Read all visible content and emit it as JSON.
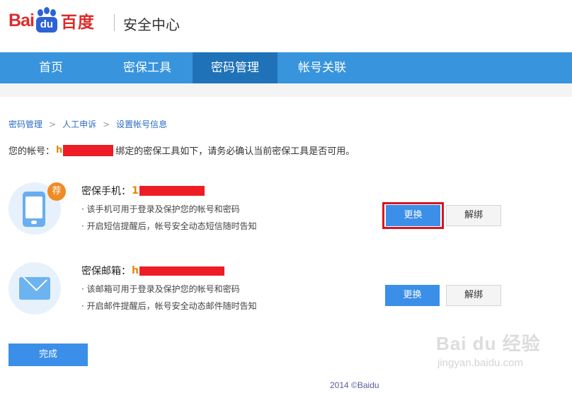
{
  "header": {
    "logo_text_left": "Bai",
    "logo_text_du": "du",
    "logo_text_cn": "百度",
    "title": "安全中心"
  },
  "nav": {
    "items": [
      {
        "label": "首页"
      },
      {
        "label": "密保工具"
      },
      {
        "label": "密码管理"
      },
      {
        "label": "帐号关联"
      }
    ],
    "active_index": 2
  },
  "breadcrumb": {
    "items": [
      "密码管理",
      "人工申诉",
      "设置帐号信息"
    ],
    "separator": ">"
  },
  "account": {
    "prefix": "您的帐号：",
    "visible_char": "h",
    "suffix": "绑定的密保工具如下，请务必确认当前密保工具是否可用。"
  },
  "phone_row": {
    "badge": "荐",
    "title_label": "密保手机：",
    "visible_char": "1",
    "desc1": "· 该手机可用于登录及保护您的帐号和密码",
    "desc2": "· 开启短信提醒后，帐号安全动态短信随时告知",
    "change_label": "更换",
    "unbind_label": "解绑"
  },
  "email_row": {
    "title_label": "密保邮箱：",
    "visible_char": "h",
    "desc1": "· 该邮箱可用于登录及保护您的帐号和密码",
    "desc2": "· 开启邮件提醒后，帐号安全动态邮件随时告知",
    "change_label": "更换",
    "unbind_label": "解绑"
  },
  "done_label": "完成",
  "footer": "2014 ©Baidu",
  "watermark": {
    "logo": "Bai du 经验",
    "url": "jingyan.baidu.com"
  },
  "colors": {
    "nav": "#3794dd",
    "nav_active": "#1f72b8",
    "primary_button": "#3b8fe8",
    "redaction": "#ee1c25",
    "highlight_outline": "#d8141e"
  }
}
